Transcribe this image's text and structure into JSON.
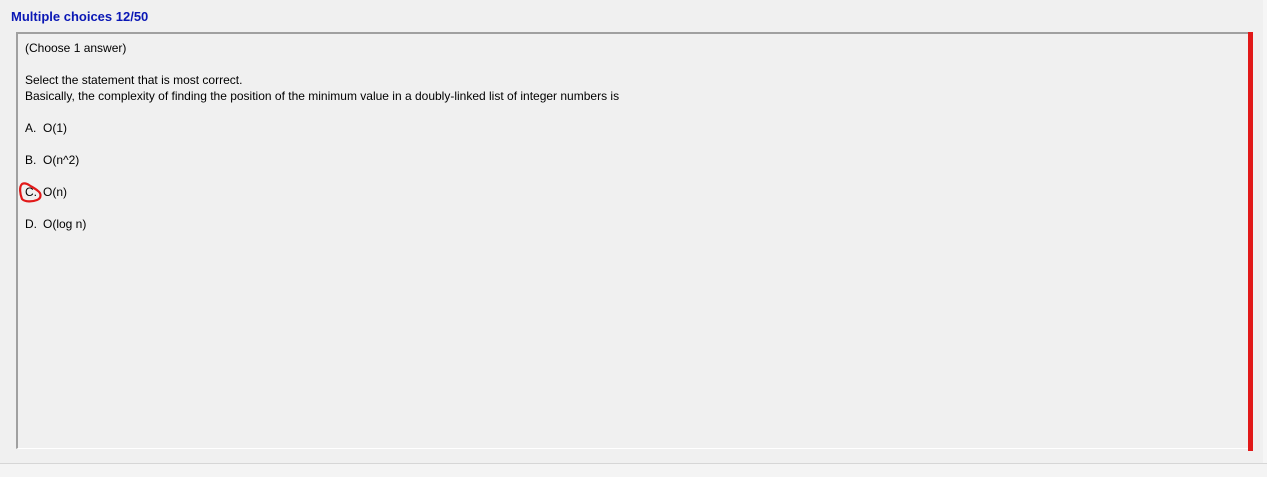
{
  "header": {
    "title": "Multiple choices 12/50"
  },
  "question": {
    "instruction": "(Choose 1 answer)",
    "prompt_line1": "Select the statement that is most correct.",
    "prompt_line2": "Basically, the complexity  of finding the position of  the minimum value in a doubly-linked list of integer numbers is",
    "options": [
      {
        "letter": "A.",
        "text": "O(1)"
      },
      {
        "letter": "B.",
        "text": "O(n^2)"
      },
      {
        "letter": "C.",
        "text": "O(n)"
      },
      {
        "letter": "D.",
        "text": "O(log n)"
      }
    ],
    "selected_option": "C."
  },
  "colors": {
    "title": "#0a17b5",
    "accent_bar": "#e11919",
    "selection_mark": "#e11919",
    "background": "#f0f0f0"
  }
}
